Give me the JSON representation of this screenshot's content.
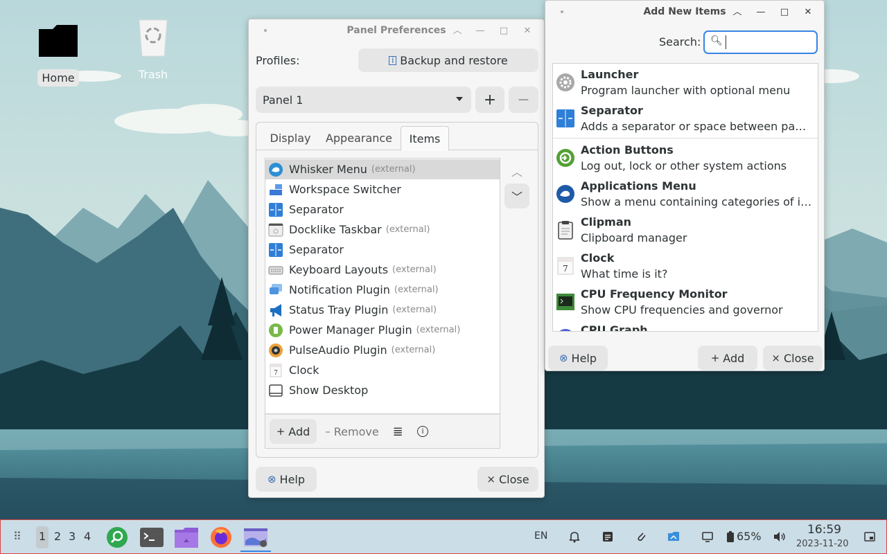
{
  "desktop": {
    "icons": [
      {
        "label": "Home"
      },
      {
        "label": "Trash"
      }
    ]
  },
  "panel_prefs": {
    "title": "Panel Preferences",
    "profiles_label": "Profiles:",
    "backup_label": "Backup and restore",
    "panel_select": "Panel 1",
    "add_panel": "+",
    "remove_panel": "−",
    "tabs": [
      {
        "label": "Display"
      },
      {
        "label": "Appearance"
      },
      {
        "label": "Items",
        "active": true
      }
    ],
    "items": [
      {
        "name": "Whisker Menu",
        "ext": "(external)",
        "icon": "whisker-menu-icon",
        "selected": true
      },
      {
        "name": "Workspace Switcher",
        "ext": "",
        "icon": "workspace-switcher-icon"
      },
      {
        "name": "Separator",
        "ext": "",
        "icon": "separator-icon"
      },
      {
        "name": "Docklike Taskbar",
        "ext": "(external)",
        "icon": "docklike-taskbar-icon"
      },
      {
        "name": "Separator",
        "ext": "",
        "icon": "separator-icon"
      },
      {
        "name": "Keyboard Layouts",
        "ext": "(external)",
        "icon": "keyboard-icon"
      },
      {
        "name": "Notification Plugin",
        "ext": "(external)",
        "icon": "notification-icon"
      },
      {
        "name": "Status Tray Plugin",
        "ext": "(external)",
        "icon": "megaphone-icon"
      },
      {
        "name": "Power Manager Plugin",
        "ext": "(external)",
        "icon": "battery-icon"
      },
      {
        "name": "PulseAudio Plugin",
        "ext": "(external)",
        "icon": "speaker-icon"
      },
      {
        "name": "Clock",
        "ext": "",
        "icon": "calendar-icon"
      },
      {
        "name": "Show Desktop",
        "ext": "",
        "icon": "show-desktop-icon"
      }
    ],
    "add_label": "Add",
    "remove_label": "Remove",
    "help_label": "Help",
    "close_label": "Close"
  },
  "add_items": {
    "title": "Add New Items",
    "search_label": "Search:",
    "search_value": "",
    "plugins": [
      {
        "name": "Launcher",
        "desc": "Program launcher with optional menu",
        "icon": "gear-icon"
      },
      {
        "name": "Separator",
        "desc": "Adds a separator or space between panel items",
        "icon": "separator-icon"
      },
      {
        "name": "Action Buttons",
        "desc": "Log out, lock or other system actions",
        "icon": "power-icon"
      },
      {
        "name": "Applications Menu",
        "desc": "Show a menu containing categories of installed applications",
        "icon": "xfce-mouse-icon"
      },
      {
        "name": "Clipman",
        "desc": "Clipboard manager",
        "icon": "clipboard-icon"
      },
      {
        "name": "Clock",
        "desc": "What time is it?",
        "icon": "calendar-icon"
      },
      {
        "name": "CPU Frequency Monitor",
        "desc": "Show CPU frequencies and governor",
        "icon": "terminal-chip-icon"
      },
      {
        "name": "CPU Graph",
        "desc": "",
        "icon": "cpu-graph-icon"
      }
    ],
    "help_label": "Help",
    "add_label": "Add",
    "close_label": "Close"
  },
  "taskbar": {
    "workspaces": [
      "1",
      "2",
      "3",
      "4"
    ],
    "keyboard_layout": "EN",
    "battery": "65%",
    "time": "16:59",
    "date": "2023-11-20"
  }
}
